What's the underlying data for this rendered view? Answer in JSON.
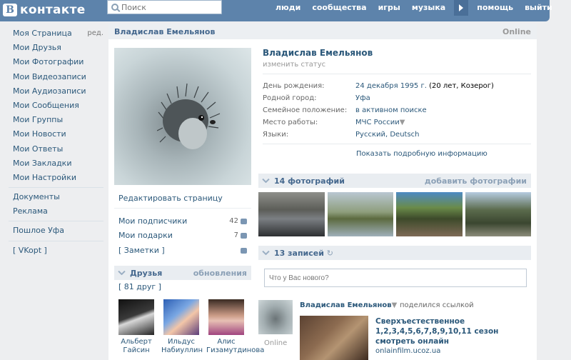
{
  "header": {
    "logo_text": "контакте",
    "logo_letter": "В",
    "search_placeholder": "Поиск",
    "nav": [
      "люди",
      "сообщества",
      "игры",
      "музыка",
      "помощь",
      "выйти"
    ]
  },
  "leftmenu": {
    "items": [
      {
        "label": "Моя Страница",
        "extra": "ред."
      },
      {
        "label": "Мои Друзья"
      },
      {
        "label": "Мои Фотографии"
      },
      {
        "label": "Мои Видеозаписи"
      },
      {
        "label": "Мои Аудиозаписи"
      },
      {
        "label": "Мои Сообщения"
      },
      {
        "label": "Мои Группы"
      },
      {
        "label": "Мои Новости"
      },
      {
        "label": "Мои Ответы"
      },
      {
        "label": "Мои Закладки"
      },
      {
        "label": "Мои Настройки"
      }
    ],
    "extra_items": [
      "Документы",
      "Реклама"
    ],
    "group_item": "Пошлое Уфа",
    "vkopt": "[ VKopt ]"
  },
  "page": {
    "title": "Владислав Емельянов",
    "online": "Online",
    "edit_page": "Редактировать страницу",
    "stats": [
      {
        "label": "Мои подписчики",
        "count": "42"
      },
      {
        "label": "Мои подарки",
        "count": "7"
      },
      {
        "label": "[ Заметки ]",
        "count": ""
      }
    ]
  },
  "friends": {
    "title": "Друзья",
    "updates": "обновления",
    "count_label": "[ 81 друг ]",
    "list": [
      {
        "first": "Альберт",
        "last": "Гайсин"
      },
      {
        "first": "Ильдус",
        "last": "Набиуллин"
      },
      {
        "first": "Алис",
        "last": "Гизамутдинова"
      }
    ]
  },
  "profile": {
    "name": "Владислав Емельянов",
    "status": "изменить статус",
    "info": [
      {
        "label": "День рождения:",
        "value": "24 декабря 1995 г.",
        "extra": " (20 лет, Козерог)"
      },
      {
        "label": "Родной город:",
        "value": "Уфа"
      },
      {
        "label": "Семейное положение:",
        "value": "в активном поиске"
      },
      {
        "label": "Место работы:",
        "value": "МЧС России"
      },
      {
        "label": "Языки:",
        "value": "Русский, Deutsch"
      }
    ],
    "more_info": "Показать подробную информацию"
  },
  "photos": {
    "title": "14 фотографий",
    "add": "добавить фотографии"
  },
  "wall": {
    "title": "13 записей",
    "input_placeholder": "Что у Вас нового?",
    "post": {
      "author": "Владислав Емельянов",
      "shared": "поделился ссылкой",
      "online": "Online",
      "link_title": "Сверхъестественное 1,2,3,4,5,6,7,8,9,10,11 сезон смотреть онлайн",
      "domain": "onlainfilm.ucoz.ua"
    }
  }
}
